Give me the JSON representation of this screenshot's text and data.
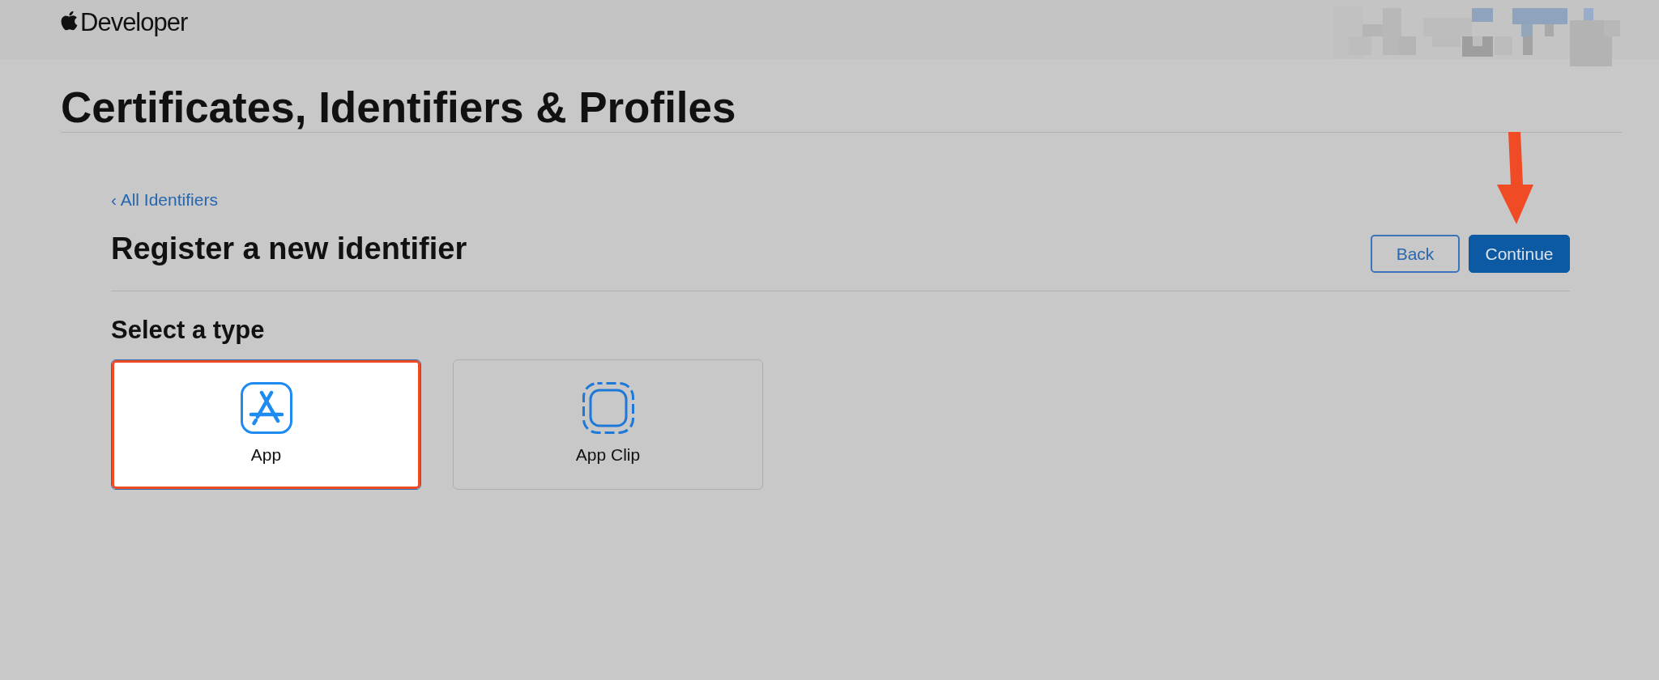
{
  "header": {
    "logo_text": "Developer"
  },
  "page_title": "Certificates, Identifiers & Profiles",
  "back_link": {
    "label": "‹ All Identifiers"
  },
  "heading": "Register a new identifier",
  "buttons": [
    {
      "label": "Back",
      "kind": "secondary"
    },
    {
      "label": "Continue",
      "kind": "primary"
    }
  ],
  "section_title": "Select a type",
  "types": [
    {
      "label": "App",
      "kind": "app",
      "selected": true,
      "highlighted": true
    },
    {
      "label": "App Clip",
      "kind": "app_clip",
      "selected": false,
      "highlighted": false
    }
  ]
}
